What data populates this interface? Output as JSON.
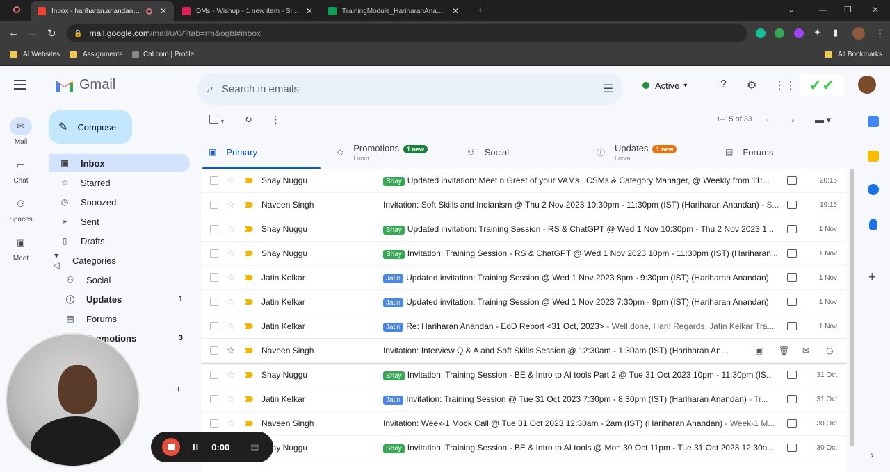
{
  "browser": {
    "tabs": [
      {
        "title": "Inbox - hariharan.anandan@w",
        "color": "#ea4335"
      },
      {
        "title": "DMs - Wishup - 1 new item - Slack",
        "color": "#e01e5a"
      },
      {
        "title": "TrainingModule_HariharanAnandan",
        "color": "#0f9d58"
      }
    ],
    "new_tab": "+",
    "url_host": "mail.google.com",
    "url_path": "/mail/u/0/?tab=rm&ogbl#inbox",
    "bookmarks": [
      "AI Websites",
      "Assignments",
      "Cal.com | Profile"
    ],
    "all_bookmarks": "All Bookmarks"
  },
  "gmail": {
    "logo_text": "Gmail",
    "search_placeholder": "Search in emails",
    "status": "Active",
    "compose_label": "Compose",
    "rail": [
      {
        "label": "Mail",
        "icon": "mail-icon"
      },
      {
        "label": "Chat",
        "icon": "chat-icon"
      },
      {
        "label": "Spaces",
        "icon": "spaces-icon"
      },
      {
        "label": "Meet",
        "icon": "meet-icon"
      }
    ],
    "nav": [
      {
        "label": "Inbox",
        "count": ""
      },
      {
        "label": "Starred",
        "count": ""
      },
      {
        "label": "Snoozed",
        "count": ""
      },
      {
        "label": "Sent",
        "count": ""
      },
      {
        "label": "Drafts",
        "count": ""
      },
      {
        "label": "Categories",
        "count": ""
      },
      {
        "label": "Social",
        "count": ""
      },
      {
        "label": "Updates",
        "count": "1"
      },
      {
        "label": "Forums",
        "count": ""
      },
      {
        "label": "Promotions",
        "count": "3"
      }
    ],
    "pager": "1–15 of 33",
    "tabs": [
      {
        "label": "Primary",
        "sub": "",
        "badge": ""
      },
      {
        "label": "Promotions",
        "sub": "Loom",
        "badge": "1 new",
        "badge_color": "#188038"
      },
      {
        "label": "Social",
        "sub": "",
        "badge": ""
      },
      {
        "label": "Updates",
        "sub": "Loom",
        "badge": "1 new",
        "badge_color": "#e8710a"
      },
      {
        "label": "Forums",
        "sub": "",
        "badge": ""
      }
    ],
    "emails": [
      {
        "sender": "Shay Nuggu",
        "label": "Shay",
        "subject": "Updated invitation: Meet n Greet of your VAMs , CSMs & Category Manager, @ Weekly from 11:...",
        "snippet": "",
        "date": "20:15"
      },
      {
        "sender": "Naveen Singh",
        "label": "",
        "subject": "Invitation: Soft Skills and Indianism @ Thu 2 Nov 2023 10:30pm - 11:30pm (IST) (Hariharan Anandan)",
        "snippet": " - S...",
        "date": "19:15"
      },
      {
        "sender": "Shay Nuggu",
        "label": "Shay",
        "subject": "Updated invitation: Training Session - RS & ChatGPT @ Wed 1 Nov 10:30pm - Thu 2 Nov 2023 1...",
        "snippet": "",
        "date": "1 Nov"
      },
      {
        "sender": "Shay Nuggu",
        "label": "Shay",
        "subject": "Invitation: Training Session - RS & ChatGPT @ Wed 1 Nov 2023 10pm - 11:30pm (IST) (Hariharan...",
        "snippet": "",
        "date": "1 Nov"
      },
      {
        "sender": "Jatin Kelkar",
        "label": "Jatin",
        "subject": "Updated invitation: Training Session @ Wed 1 Nov 2023 8pm - 9:30pm (IST) (Hariharan Anandan)",
        "snippet": "",
        "date": "1 Nov"
      },
      {
        "sender": "Jatin Kelkar",
        "label": "Jatin",
        "subject": "Updated invitation: Training Session @ Wed 1 Nov 2023 7:30pm - 9pm (IST) (Hariharan Anandan)",
        "snippet": "",
        "date": "1 Nov"
      },
      {
        "sender": "Jatin Kelkar",
        "label": "Jatin",
        "subject": "Re: Hariharan Anandan - EoD Report <31 Oct, 2023>",
        "snippet": " - Well done, Hari! Regards, Jatin Kelkar Tra...",
        "date": "1 Nov"
      },
      {
        "sender": "Naveen Singh",
        "label": "",
        "subject": "Invitation: Interview Q & A and Soft Skills Session @ 12:30am - 1:30am (IST) (Hariharan Ana...",
        "snippet": "",
        "date": ""
      },
      {
        "sender": "Shay Nuggu",
        "label": "Shay",
        "subject": "Invitation: Training Session - BE & Intro to AI tools Part 2 @ Tue 31 Oct 2023 10pm - 11:30pm (IS...",
        "snippet": "",
        "date": "31 Oct"
      },
      {
        "sender": "Jatin Kelkar",
        "label": "Jatin",
        "subject": "Invitation: Training Session @ Tue 31 Oct 2023 7:30pm - 8:30pm (IST) (Hariharan Anandan)",
        "snippet": " - Tr...",
        "date": "31 Oct"
      },
      {
        "sender": "Naveen Singh",
        "label": "",
        "subject": "Invitation: Week-1 Mock Call @ Tue 31 Oct 2023 12:30am - 2am (IST) (Hariharan Anandan)",
        "snippet": " - Week-1 M...",
        "date": "30 Oct"
      },
      {
        "sender": "Shay Nuggu",
        "label": "Shay",
        "subject": "Invitation: Training Session - BE & Intro to AI tools @ Mon 30 Oct 11pm - Tue 31 Oct 2023 12:30a...",
        "snippet": "",
        "date": "30 Oct"
      }
    ],
    "label_colors": {
      "Shay": "#34a853",
      "Jatin": "#4a86e8"
    }
  },
  "recorder": {
    "time": "0:00"
  }
}
